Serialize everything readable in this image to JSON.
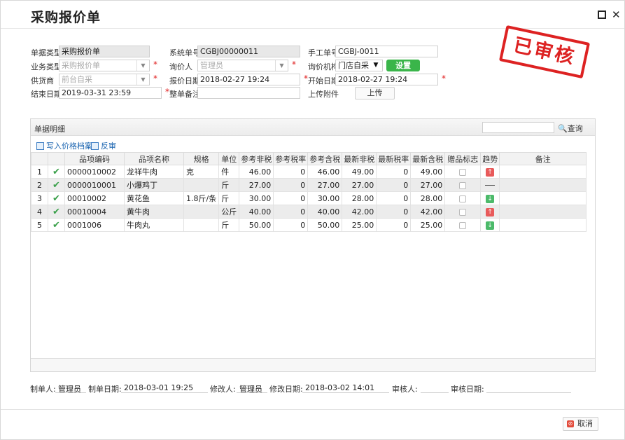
{
  "window": {
    "title": "采购报价单"
  },
  "stamp": {
    "text": "已审核",
    "color": "#dd2222"
  },
  "form": {
    "doc_type_label": "单据类型",
    "doc_type_value": "采购报价单",
    "sys_no_label": "系统单号",
    "sys_no_value": "CGBJ00000011",
    "manual_no_label": "手工单号",
    "manual_no_value": "CGBJ-0011",
    "biz_type_label": "业务类型",
    "biz_type_value": "采购报价单",
    "inquirer_label": "询价人",
    "inquirer_value": "管理员",
    "inquiry_org_label": "询价机构",
    "inquiry_org_value": "门店自采",
    "settings_button": "设置",
    "supplier_label": "供货商",
    "supplier_value": "前台自采",
    "quote_date_label": "报价日期",
    "quote_date_value": "2018-02-27 19:24",
    "start_date_label": "开始日期",
    "start_date_value": "2018-02-27 19:24",
    "end_date_label": "结束日期",
    "end_date_value": "2019-03-31 23:59",
    "remark_label": "整单备注",
    "remark_value": "",
    "attach_label": "上传附件",
    "upload_button": "上传",
    "required_mark": "*"
  },
  "detail": {
    "title": "单据明细",
    "search_placeholder": "",
    "search_button": "查询",
    "toolbar": {
      "write_price": "写入价格档案",
      "unaudit": "反审"
    },
    "columns": [
      "",
      "",
      "品项编码",
      "品项名称",
      "规格",
      "单位",
      "参考非税",
      "参考税率",
      "参考含税",
      "最新非税",
      "最新税率",
      "最新含税",
      "赠品标志",
      "趋势",
      "备注"
    ],
    "rows": [
      {
        "no": "1",
        "code": "0000010002",
        "name": "龙祥牛肉",
        "spec": "克",
        "unit": "件",
        "ref_net": "46.00",
        "ref_rate": "0",
        "ref_gross": "46.00",
        "new_net": "49.00",
        "new_rate": "0",
        "new_gross": "49.00",
        "trend": "up"
      },
      {
        "no": "2",
        "code": "0000010001",
        "name": "小爆鸡丁",
        "spec": "",
        "unit": "斤",
        "ref_net": "27.00",
        "ref_rate": "0",
        "ref_gross": "27.00",
        "new_net": "27.00",
        "new_rate": "0",
        "new_gross": "27.00",
        "trend": "flat"
      },
      {
        "no": "3",
        "code": "00010002",
        "name": "黄花鱼",
        "spec": "1.8斤/条",
        "unit": "斤",
        "ref_net": "30.00",
        "ref_rate": "0",
        "ref_gross": "30.00",
        "new_net": "28.00",
        "new_rate": "0",
        "new_gross": "28.00",
        "trend": "down"
      },
      {
        "no": "4",
        "code": "00010004",
        "name": "黄牛肉",
        "spec": "",
        "unit": "公斤",
        "ref_net": "40.00",
        "ref_rate": "0",
        "ref_gross": "40.00",
        "new_net": "42.00",
        "new_rate": "0",
        "new_gross": "42.00",
        "trend": "up"
      },
      {
        "no": "5",
        "code": "0001006",
        "name": "牛肉丸",
        "spec": "",
        "unit": "斤",
        "ref_net": "50.00",
        "ref_rate": "0",
        "ref_gross": "50.00",
        "new_net": "25.00",
        "new_rate": "0",
        "new_gross": "25.00",
        "trend": "down"
      }
    ]
  },
  "footer": {
    "creator_label": "制单人:",
    "creator_value": "管理员",
    "create_date_label": "制单日期:",
    "create_date_value": "2018-03-01 19:25",
    "modifier_label": "修改人:",
    "modifier_value": "管理员",
    "modify_date_label": "修改日期:",
    "modify_date_value": "2018-03-02 14:01",
    "auditor_label": "审核人:",
    "auditor_value": "",
    "audit_date_label": "审核日期:",
    "audit_date_value": "",
    "cancel_button": "取消"
  }
}
